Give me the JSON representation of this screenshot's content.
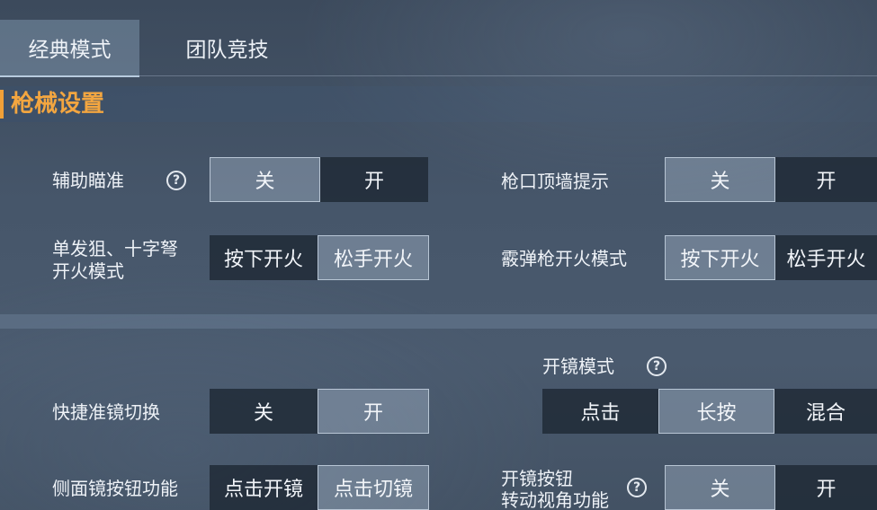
{
  "tabs": [
    {
      "label": "经典模式",
      "active": true
    },
    {
      "label": "团队竞技",
      "active": false
    }
  ],
  "section": {
    "title": "枪械设置"
  },
  "settings": {
    "aim_assist": {
      "label": "辅助瞄准",
      "options": [
        "关",
        "开"
      ],
      "selected": "关"
    },
    "muzzle_wall": {
      "label": "枪口顶墙提示",
      "options": [
        "关",
        "开"
      ],
      "selected": "关"
    },
    "sniper_fire": {
      "label_line1": "单发狙、十字弩",
      "label_line2": "开火模式",
      "options": [
        "按下开火",
        "松手开火"
      ],
      "selected": "松手开火"
    },
    "shotgun_fire": {
      "label": "霰弹枪开火模式",
      "options": [
        "按下开火",
        "松手开火"
      ],
      "selected": "按下开火"
    },
    "scope_mode": {
      "label": "开镜模式",
      "options": [
        "点击",
        "长按",
        "混合"
      ],
      "selected": "长按"
    },
    "quick_scope": {
      "label": "快捷准镜切换",
      "options": [
        "关",
        "开"
      ],
      "selected": "开"
    },
    "side_scope": {
      "label": "侧面镜按钮功能",
      "options": [
        "点击开镜",
        "点击切镜"
      ],
      "selected": "点击切镜"
    },
    "scope_rotate": {
      "label_line1": "开镜按钮",
      "label_line2": "转动视角功能",
      "options": [
        "关",
        "开"
      ],
      "selected": "关"
    }
  },
  "icons": {
    "help": "question-circle-icon"
  },
  "colors": {
    "accent": "#f3a640",
    "selected_bg": "#8d9cae",
    "unselected_bg": "#1c2632"
  }
}
